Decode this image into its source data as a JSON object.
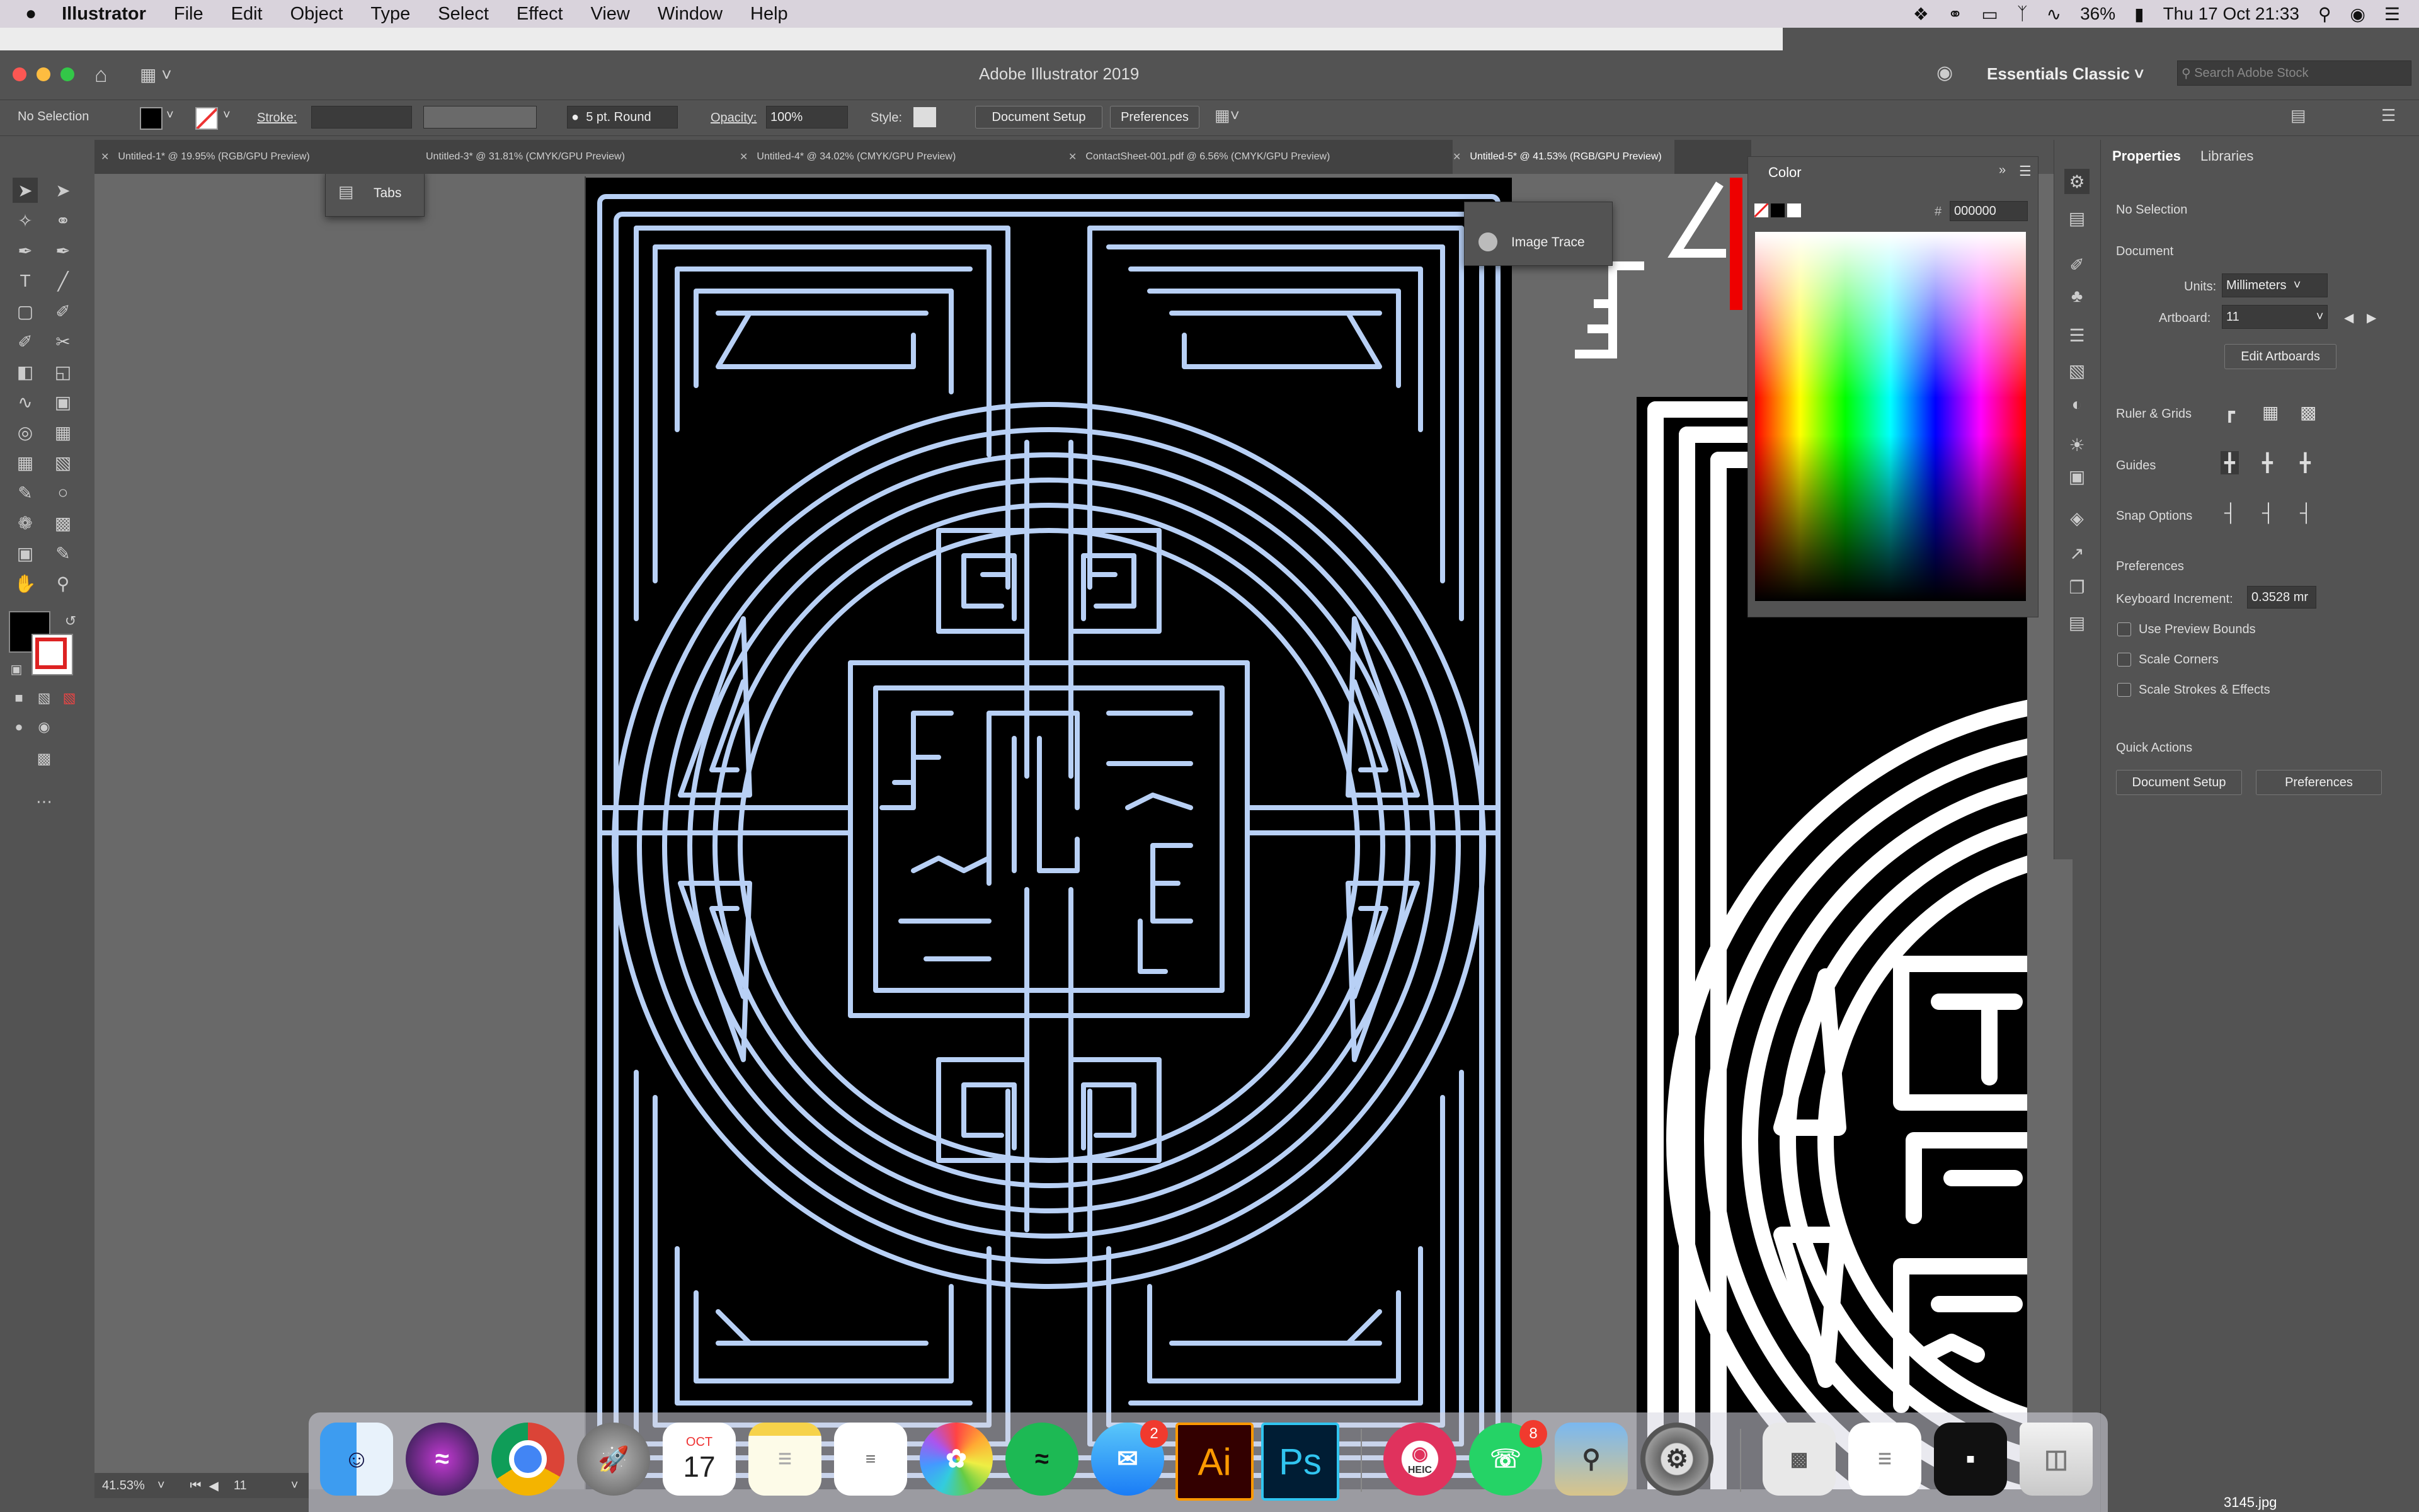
{
  "menubar": {
    "apple": "",
    "app_name": "Illustrator",
    "items": [
      "File",
      "Edit",
      "Object",
      "Type",
      "Select",
      "Effect",
      "View",
      "Window",
      "Help"
    ],
    "battery": "36%",
    "clock": "Thu 17 Oct  21:33"
  },
  "window": {
    "title": "Adobe Illustrator 2019",
    "workspace": "Essentials Classic",
    "search_placeholder": "Search Adobe Stock"
  },
  "control": {
    "selection": "No Selection",
    "stroke_label": "Stroke:",
    "brush": "5 pt. Round",
    "opacity_label": "Opacity:",
    "opacity_value": "100%",
    "style_label": "Style:",
    "document_setup": "Document Setup",
    "preferences": "Preferences"
  },
  "tabs": [
    {
      "label": "Untitled-1* @ 19.95% (RGB/GPU Preview)"
    },
    {
      "label": "Untitled-3* @ 31.81% (CMYK/GPU Preview)"
    },
    {
      "label": "Untitled-4* @ 34.02% (CMYK/GPU Preview)"
    },
    {
      "label": "ContactSheet-001.pdf @ 6.56% (CMYK/GPU Preview)"
    },
    {
      "label": "Untitled-5* @ 41.53% (RGB/GPU Preview)"
    }
  ],
  "floating": {
    "tabs_panel": "Tabs",
    "image_trace": "Image Trace"
  },
  "color_panel": {
    "title": "Color",
    "hex_label": "#",
    "hex_value": "000000"
  },
  "properties": {
    "tab_properties": "Properties",
    "tab_libraries": "Libraries",
    "selection": "No Selection",
    "document": "Document",
    "units_label": "Units:",
    "units_value": "Millimeters",
    "artboard_label": "Artboard:",
    "artboard_value": "11",
    "edit_artboards": "Edit Artboards",
    "ruler_grids": "Ruler & Grids",
    "guides": "Guides",
    "snap_options": "Snap Options",
    "preferences": "Preferences",
    "keyboard_increment_label": "Keyboard Increment:",
    "keyboard_increment_value": "0.3528 mr",
    "use_preview_bounds": "Use Preview Bounds",
    "scale_corners": "Scale Corners",
    "scale_strokes": "Scale Strokes & Effects",
    "quick_actions": "Quick Actions",
    "qa_document_setup": "Document Setup",
    "qa_preferences": "Preferences"
  },
  "status": {
    "zoom": "41.53%",
    "artboard": "11"
  },
  "dock": {
    "calendar_month": "OCT",
    "calendar_day": "17",
    "messages_badge": "2",
    "whatsapp_badge": "8",
    "ai_label": "Ai",
    "ps_label": "Ps",
    "heic_label": "HEIC",
    "file_label": "3145.jpg"
  }
}
